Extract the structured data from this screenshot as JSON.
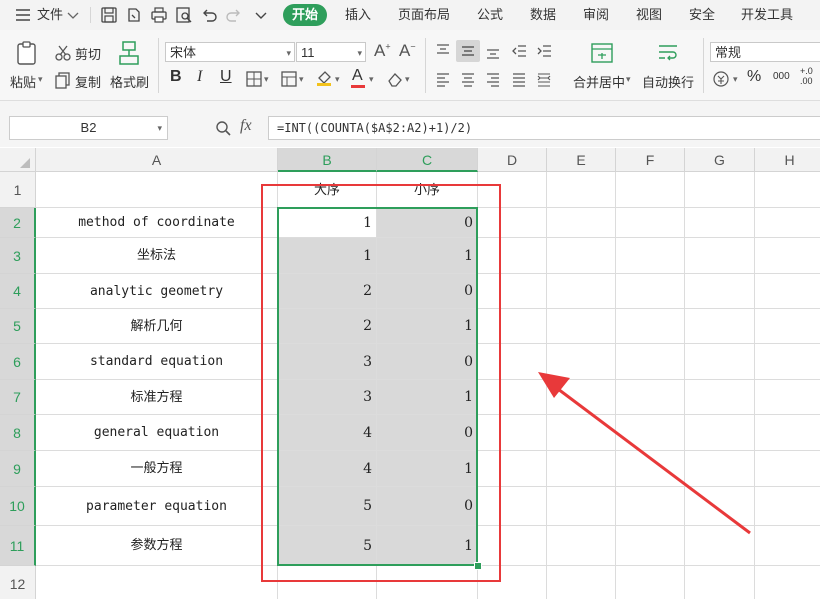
{
  "menu": {
    "items": [
      "文件",
      "开始",
      "插入",
      "页面布局",
      "公式",
      "数据",
      "审阅",
      "视图",
      "安全",
      "开发工具"
    ]
  },
  "ribbon": {
    "paste": "粘贴",
    "cut": "剪切",
    "copy": "复制",
    "format_painter": "格式刷",
    "font_name": "宋体",
    "font_size": "11",
    "merge_center": "合并居中",
    "wrap_text": "自动换行",
    "number_format": "常规",
    "percent": "%",
    "thousands": "000",
    "decimal_inc": "+.0",
    "decimal_dec": ".00"
  },
  "formula_bar": {
    "cell_ref": "B2",
    "fx": "fx",
    "formula": "=INT((COUNTA($A$2:A2)+1)/2)"
  },
  "sheet": {
    "columns": [
      "A",
      "B",
      "C",
      "D",
      "E",
      "F",
      "G",
      "H"
    ],
    "rows": [
      "1",
      "2",
      "3",
      "4",
      "5",
      "6",
      "7",
      "8",
      "9",
      "10",
      "11",
      "12"
    ],
    "header_row": {
      "b": "大序",
      "c": "小序"
    },
    "data": [
      {
        "a": "method of coordinate",
        "b": "1",
        "c": "0"
      },
      {
        "a": "坐标法",
        "b": "1",
        "c": "1"
      },
      {
        "a": "analytic geometry",
        "b": "2",
        "c": "0"
      },
      {
        "a": "解析几何",
        "b": "2",
        "c": "1"
      },
      {
        "a": "standard equation",
        "b": "3",
        "c": "0"
      },
      {
        "a": "标准方程",
        "b": "3",
        "c": "1"
      },
      {
        "a": "general equation",
        "b": "4",
        "c": "0"
      },
      {
        "a": "一般方程",
        "b": "4",
        "c": "1"
      },
      {
        "a": "parameter  equation",
        "b": "5",
        "c": "0"
      },
      {
        "a": "参数方程",
        "b": "5",
        "c": "1"
      }
    ]
  },
  "colors": {
    "accent": "#2e9e5b",
    "annotation": "#e8393a",
    "selection_fill": "#d9d9d9"
  }
}
